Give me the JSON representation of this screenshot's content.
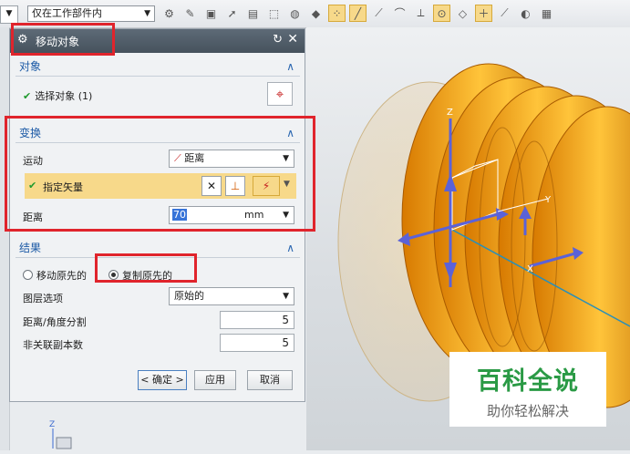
{
  "toolbar": {
    "filter_value": "仅在工作部件内",
    "dropdown_arrow": "▼"
  },
  "dialog": {
    "title": "移动对象",
    "reset_glyph": "↻",
    "close_glyph": "✕",
    "object_section": {
      "title": "对象",
      "select_label": "选择对象 (1)"
    },
    "transform_section": {
      "title": "变换",
      "motion_label": "运动",
      "motion_value": "距离",
      "vector_label": "指定矢量",
      "distance_label": "距离",
      "distance_value": "70",
      "distance_unit": "mm"
    },
    "result_section": {
      "title": "结果",
      "move_original_label": "移动原先的",
      "copy_original_label": "复制原先的",
      "layer_option_label": "图层选项",
      "layer_option_value": "原始的",
      "distance_angle_split_label": "距离/角度分割",
      "distance_angle_split_value": "5",
      "non_assoc_copies_label": "非关联副本数",
      "non_assoc_copies_value": "5"
    },
    "buttons": {
      "ok": "< 确定 >",
      "apply": "应用",
      "cancel": "取消"
    }
  },
  "viewport": {
    "axis_z": "Z",
    "axis_y": "Y",
    "axis_x": "X",
    "corner_axis_z": "Z"
  },
  "watermark": {
    "title": "百科全说",
    "subtitle": "助你轻松解决"
  },
  "colors": {
    "accent_red": "#e0242c",
    "highlight_yellow": "#f7d98a",
    "spring_orange": "#f5a623",
    "watermark_green": "#2a9a45"
  }
}
